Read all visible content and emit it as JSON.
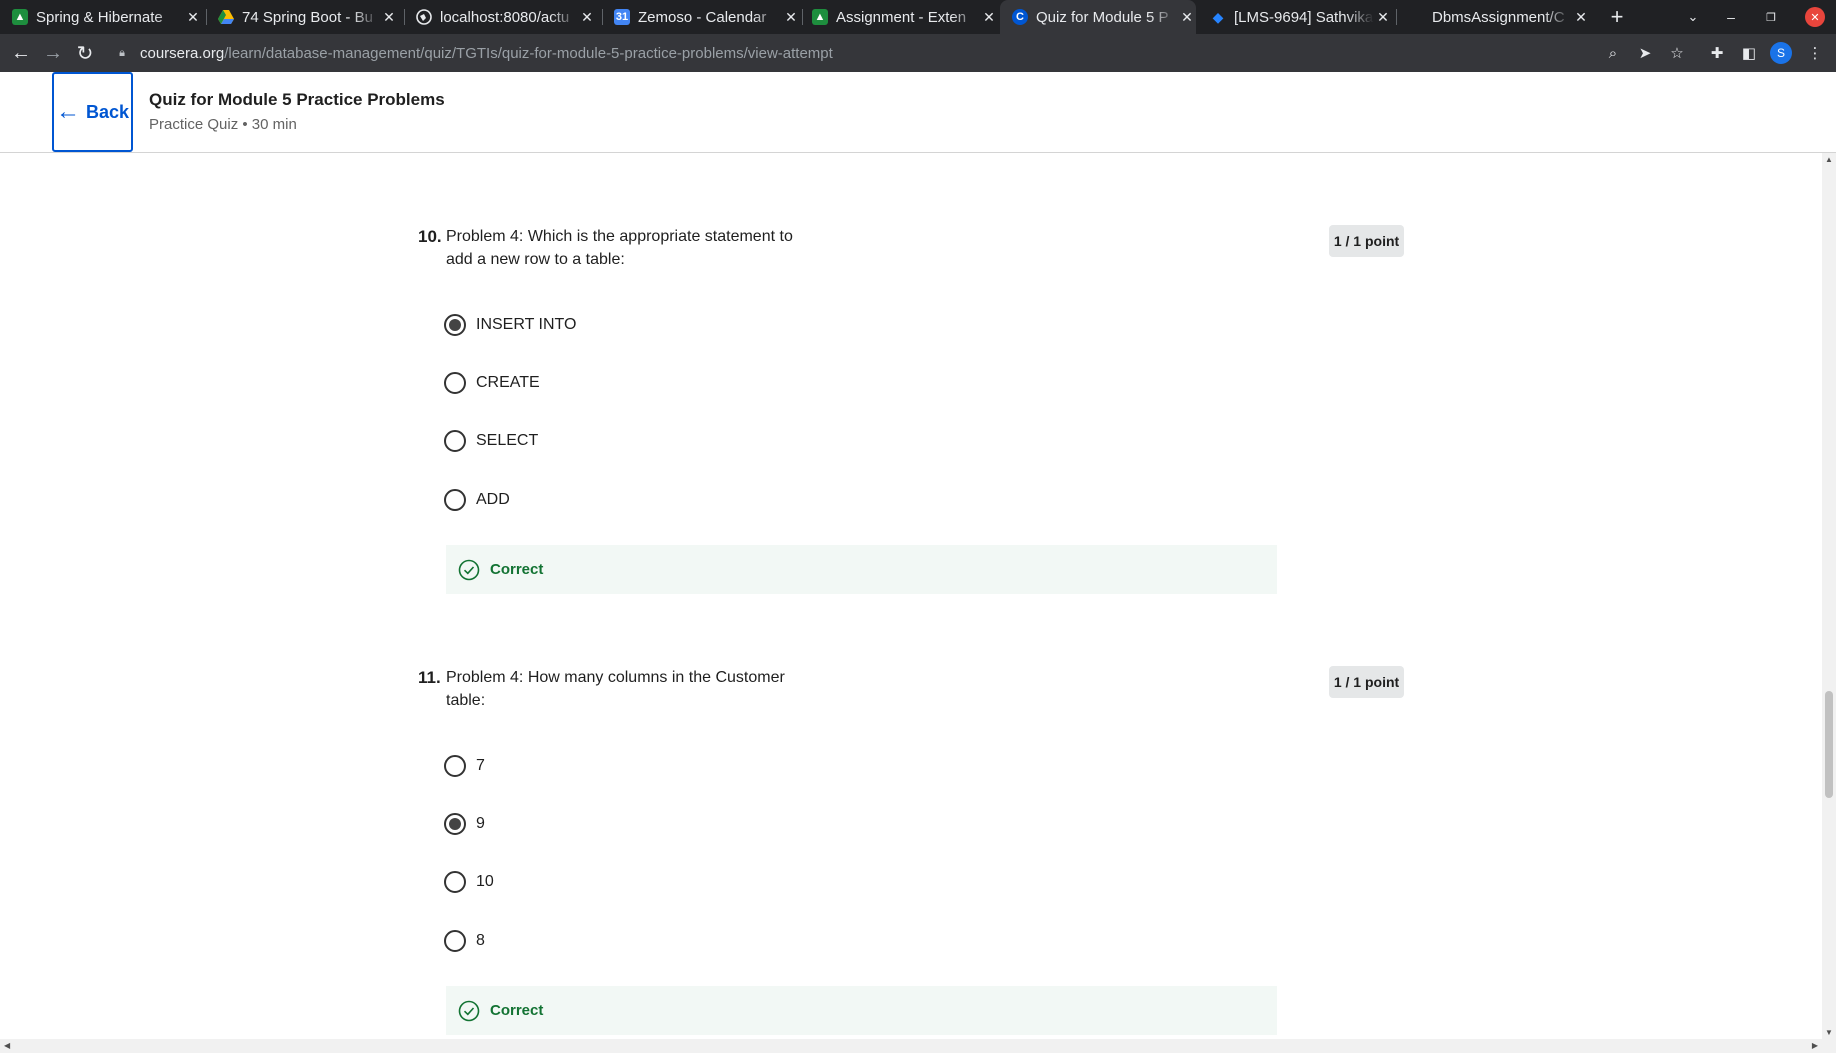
{
  "browser": {
    "tabs": [
      {
        "title": "Spring & Hibernate",
        "icon": "classroom-icon",
        "color": "#1e8e3e"
      },
      {
        "title": "74 Spring Boot - Bu",
        "icon": "drive-icon",
        "color": "#fbbc04"
      },
      {
        "title": "localhost:8080/actu",
        "icon": "globe-icon",
        "color": "#e8eaed"
      },
      {
        "title": "Zemoso - Calendar",
        "icon": "calendar-icon",
        "color": "#4285f4"
      },
      {
        "title": "Assignment - Exten",
        "icon": "classroom-icon",
        "color": "#1e8e3e"
      },
      {
        "title": "Quiz for Module 5 P",
        "icon": "coursera-icon",
        "color": "#0056d2"
      },
      {
        "title": "[LMS-9694] Sathvika",
        "icon": "jira-icon",
        "color": "#2684ff"
      },
      {
        "title": "DbmsAssignment/C",
        "icon": "github-icon",
        "color": "#202124"
      }
    ],
    "active_tab": 5,
    "url_host": "coursera.org",
    "url_path": "/learn/database-management/quiz/TGTIs/quiz-for-module-5-practice-problems/view-attempt",
    "profile_initial": "S"
  },
  "header": {
    "back_label": "Back",
    "title": "Quiz for Module 5 Practice Problems",
    "subtitle": "Practice Quiz • 30 min"
  },
  "questions": [
    {
      "number": "10.",
      "text": "Problem 4: Which is the appropriate statement to add a new row to a table:",
      "points": "1 / 1 point",
      "options": [
        {
          "label": "INSERT INTO",
          "selected": true
        },
        {
          "label": "CREATE",
          "selected": false
        },
        {
          "label": "SELECT",
          "selected": false
        },
        {
          "label": "ADD",
          "selected": false
        }
      ],
      "feedback": "Correct"
    },
    {
      "number": "11.",
      "text": "Problem 4: How many columns in the Customer table:",
      "points": "1 / 1 point",
      "options": [
        {
          "label": "7",
          "selected": false
        },
        {
          "label": "9",
          "selected": true
        },
        {
          "label": "10",
          "selected": false
        },
        {
          "label": "8",
          "selected": false
        }
      ],
      "feedback": "Correct"
    }
  ],
  "colors": {
    "accent": "#0056d2",
    "correct": "#137333",
    "correct_bg": "#f2f8f5"
  }
}
